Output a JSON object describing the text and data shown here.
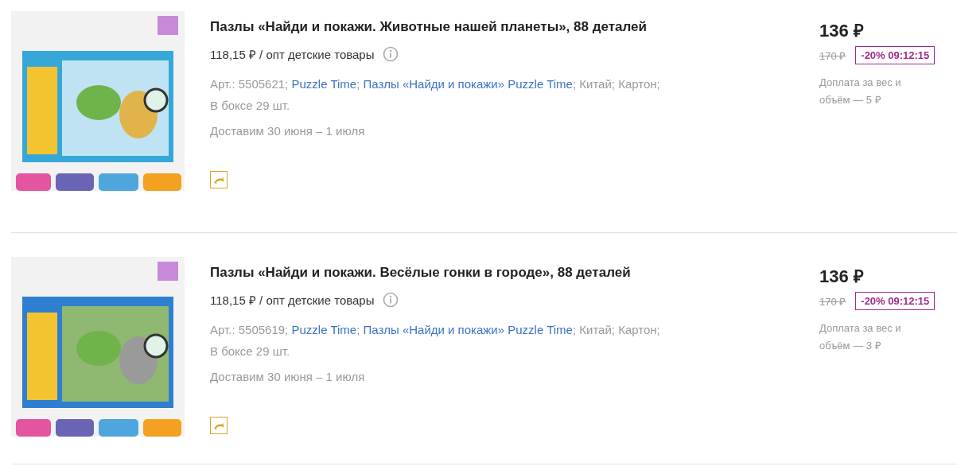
{
  "products": [
    {
      "title": "Пазлы «Найди и покажи. Животные нашей планеты», 88 деталей",
      "wholesale": "118,15 ₽ / опт детские товары",
      "meta": [
        {
          "kind": "text",
          "text": "Арт.: 5505621; "
        },
        {
          "kind": "link",
          "text": "Puzzle Time"
        },
        {
          "kind": "text",
          "text": "; "
        },
        {
          "kind": "link",
          "text": "Пазлы «Найди и покажи» Puzzle Time"
        },
        {
          "kind": "text",
          "text": "; Китай; Картон;"
        },
        {
          "kind": "line",
          "text": "В боксе 29 шт."
        }
      ],
      "delivery": "Доставим 30 июня – 1 июля",
      "price": "136 ₽",
      "old_price": "170 ₽",
      "discount": "-20% 09:12:15",
      "surcharge": "Доплата за вес и объём — 5 ₽"
    },
    {
      "title": "Пазлы «Найди и покажи. Весёлые гонки в городе», 88 деталей",
      "wholesale": "118,15 ₽ / опт детские товары",
      "meta": [
        {
          "kind": "text",
          "text": "Арт.: 5505619; "
        },
        {
          "kind": "link",
          "text": "Puzzle Time"
        },
        {
          "kind": "text",
          "text": "; "
        },
        {
          "kind": "link",
          "text": "Пазлы «Найди и покажи» Puzzle Time"
        },
        {
          "kind": "text",
          "text": "; Китай; Картон;"
        },
        {
          "kind": "line",
          "text": "В боксе 29 шт."
        }
      ],
      "delivery": "Доставим 30 июня – 1 июля",
      "price": "136 ₽",
      "old_price": "170 ₽",
      "discount": "-20% 09:12:15",
      "surcharge": "Доплата за вес и объём — 3 ₽"
    }
  ]
}
